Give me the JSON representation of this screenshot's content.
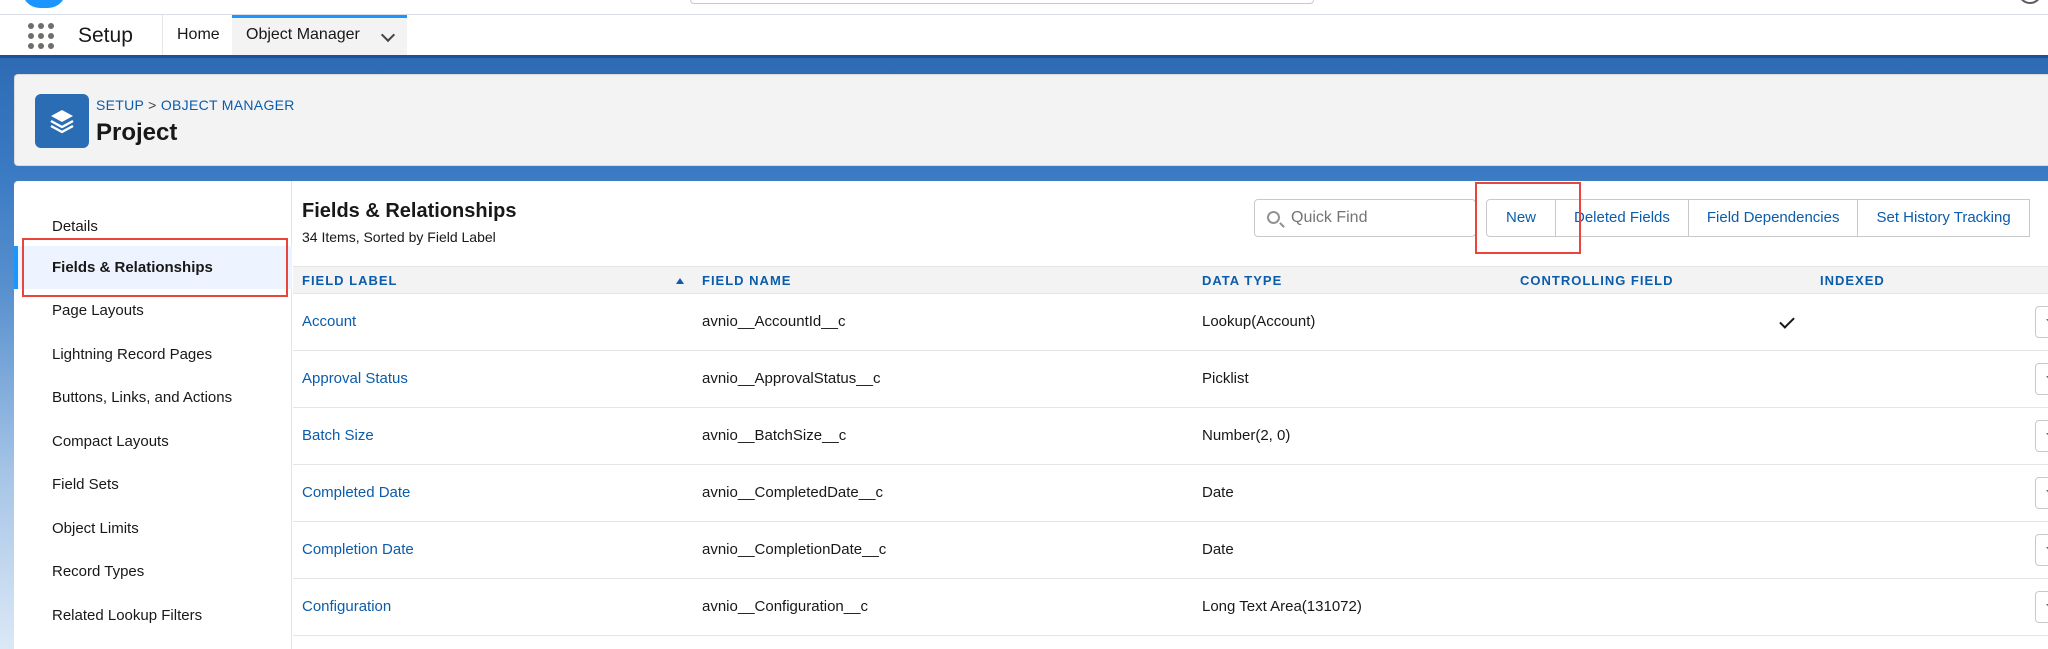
{
  "nav": {
    "app_name": "Setup",
    "tabs": [
      {
        "label": "Home"
      },
      {
        "label": "Object Manager"
      }
    ]
  },
  "header": {
    "breadcrumb_setup": "SETUP",
    "breadcrumb_sep": ">",
    "breadcrumb_object_manager": "OBJECT MANAGER",
    "title": "Project"
  },
  "sidebar": {
    "items": [
      {
        "label": "Details"
      },
      {
        "label": "Fields & Relationships"
      },
      {
        "label": "Page Layouts"
      },
      {
        "label": "Lightning Record Pages"
      },
      {
        "label": "Buttons, Links, and Actions"
      },
      {
        "label": "Compact Layouts"
      },
      {
        "label": "Field Sets"
      },
      {
        "label": "Object Limits"
      },
      {
        "label": "Record Types"
      },
      {
        "label": "Related Lookup Filters"
      }
    ],
    "selected": "Fields & Relationships"
  },
  "main": {
    "title": "Fields & Relationships",
    "subtitle": "34 Items, Sorted by Field Label",
    "quick_find_placeholder": "Quick Find",
    "buttons": {
      "new": "New",
      "deleted_fields": "Deleted Fields",
      "field_dependencies": "Field Dependencies",
      "set_history_tracking": "Set History Tracking"
    }
  },
  "table": {
    "columns": [
      "FIELD LABEL",
      "FIELD NAME",
      "DATA TYPE",
      "CONTROLLING FIELD",
      "INDEXED"
    ],
    "rows": [
      {
        "label": "Account",
        "name": "avnio__AccountId__c",
        "type": "Lookup(Account)",
        "controlling": "",
        "indexed": true
      },
      {
        "label": "Approval Status",
        "name": "avnio__ApprovalStatus__c",
        "type": "Picklist",
        "controlling": "",
        "indexed": false
      },
      {
        "label": "Batch Size",
        "name": "avnio__BatchSize__c",
        "type": "Number(2, 0)",
        "controlling": "",
        "indexed": false
      },
      {
        "label": "Completed Date",
        "name": "avnio__CompletedDate__c",
        "type": "Date",
        "controlling": "",
        "indexed": false
      },
      {
        "label": "Completion Date",
        "name": "avnio__CompletionDate__c",
        "type": "Date",
        "controlling": "",
        "indexed": false
      },
      {
        "label": "Configuration",
        "name": "avnio__Configuration__c",
        "type": "Long Text Area(131072)",
        "controlling": "",
        "indexed": false
      }
    ]
  },
  "colors": {
    "brand_blue": "#1b96ff",
    "link_blue": "#0b5cab",
    "highlight_red": "#e8453c"
  }
}
